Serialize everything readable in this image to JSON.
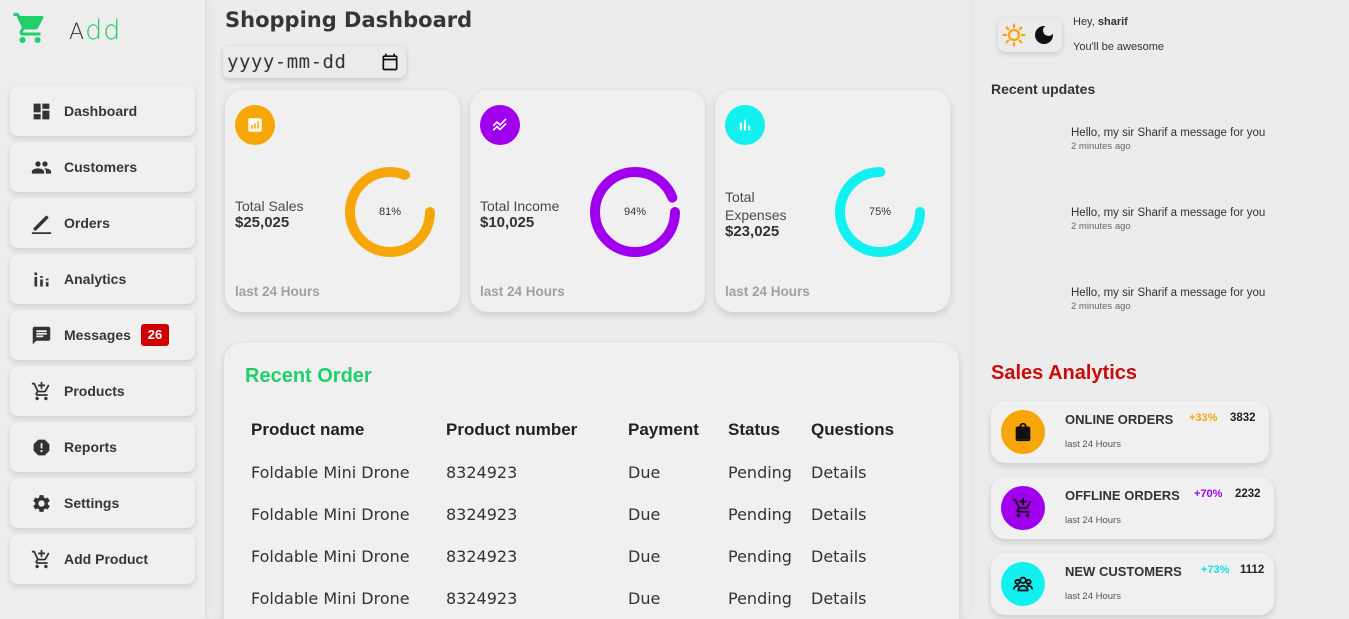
{
  "brand": {
    "first_letter": "A",
    "rest": "dd",
    "accent": "#1fd06a"
  },
  "sidebar": {
    "items": [
      {
        "label": "Dashboard",
        "icon": "dashboard-icon"
      },
      {
        "label": "Customers",
        "icon": "people-icon"
      },
      {
        "label": "Orders",
        "icon": "edit-icon"
      },
      {
        "label": "Analytics",
        "icon": "analytics-icon"
      },
      {
        "label": "Messages",
        "icon": "message-icon",
        "badge": "26"
      },
      {
        "label": "Products",
        "icon": "cart-icon"
      },
      {
        "label": "Reports",
        "icon": "report-icon"
      },
      {
        "label": "Settings",
        "icon": "settings-icon"
      },
      {
        "label": "Add Product",
        "icon": "add-cart-icon"
      }
    ]
  },
  "main": {
    "title": "Shopping Dashboard",
    "date_input": {
      "placeholder": "yyyy-mm-dd"
    },
    "cards": [
      {
        "label": "Total Sales",
        "value": "$25,025",
        "percent": 81,
        "percent_label": "81%",
        "footer": "last 24 Hours",
        "color": "#f6a609",
        "icon": "chart-icon"
      },
      {
        "label": "Total Income",
        "value": "$10,025",
        "percent": 94,
        "percent_label": "94%",
        "footer": "last 24 Hours",
        "color": "#a000ee",
        "icon": "trending-icon"
      },
      {
        "label": "Total Expenses",
        "label_line1": "Total",
        "label_line2": "Expenses",
        "value": "$23,025",
        "percent": 75,
        "percent_label": "75%",
        "footer": "last 24 Hours",
        "color": "#12f0f0",
        "icon": "bars-icon"
      }
    ],
    "recent_order": {
      "title": "Recent Order",
      "columns": [
        "Product name",
        "Product number",
        "Payment",
        "Status",
        "Questions"
      ],
      "rows": [
        [
          "Foldable Mini Drone",
          "8324923",
          "Due",
          "Pending",
          "Details"
        ],
        [
          "Foldable Mini Drone",
          "8324923",
          "Due",
          "Pending",
          "Details"
        ],
        [
          "Foldable Mini Drone",
          "8324923",
          "Due",
          "Pending",
          "Details"
        ],
        [
          "Foldable Mini Drone",
          "8324923",
          "Due",
          "Pending",
          "Details"
        ]
      ]
    }
  },
  "right": {
    "greeting_prefix": "Hey,",
    "greeting_name": "sharif",
    "greeting_sub": "You'll be awesome",
    "updates_title": "Recent updates",
    "updates": [
      {
        "message": "Hello, my sir Sharif a message for you",
        "time": "2 minutes ago"
      },
      {
        "message": "Hello, my sir Sharif a message for you",
        "time": "2 minutes ago"
      },
      {
        "message": "Hello, my sir Sharif a message for you",
        "time": "2 minutes ago"
      }
    ],
    "sales_title": "Sales Analytics",
    "analytics": [
      {
        "name": "ONLINE ORDERS",
        "pct": "+33%",
        "value": "3832",
        "sub": "last 24 Hours",
        "color": "#f6a609",
        "icon": "shopping-bag-icon"
      },
      {
        "name": "OFFLINE ORDERS",
        "pct": "+70%",
        "value": "2232",
        "sub": "last 24 Hours",
        "color": "#a000ee",
        "icon": "add-cart-icon"
      },
      {
        "name": "NEW CUSTOMERS",
        "pct": "+73%",
        "value": "1112",
        "sub": "last 24 Hours",
        "color": "#12f0f0",
        "icon": "group-icon"
      }
    ],
    "theme": {
      "sun_color": "#f6a609",
      "moon_color": "#111111"
    }
  }
}
